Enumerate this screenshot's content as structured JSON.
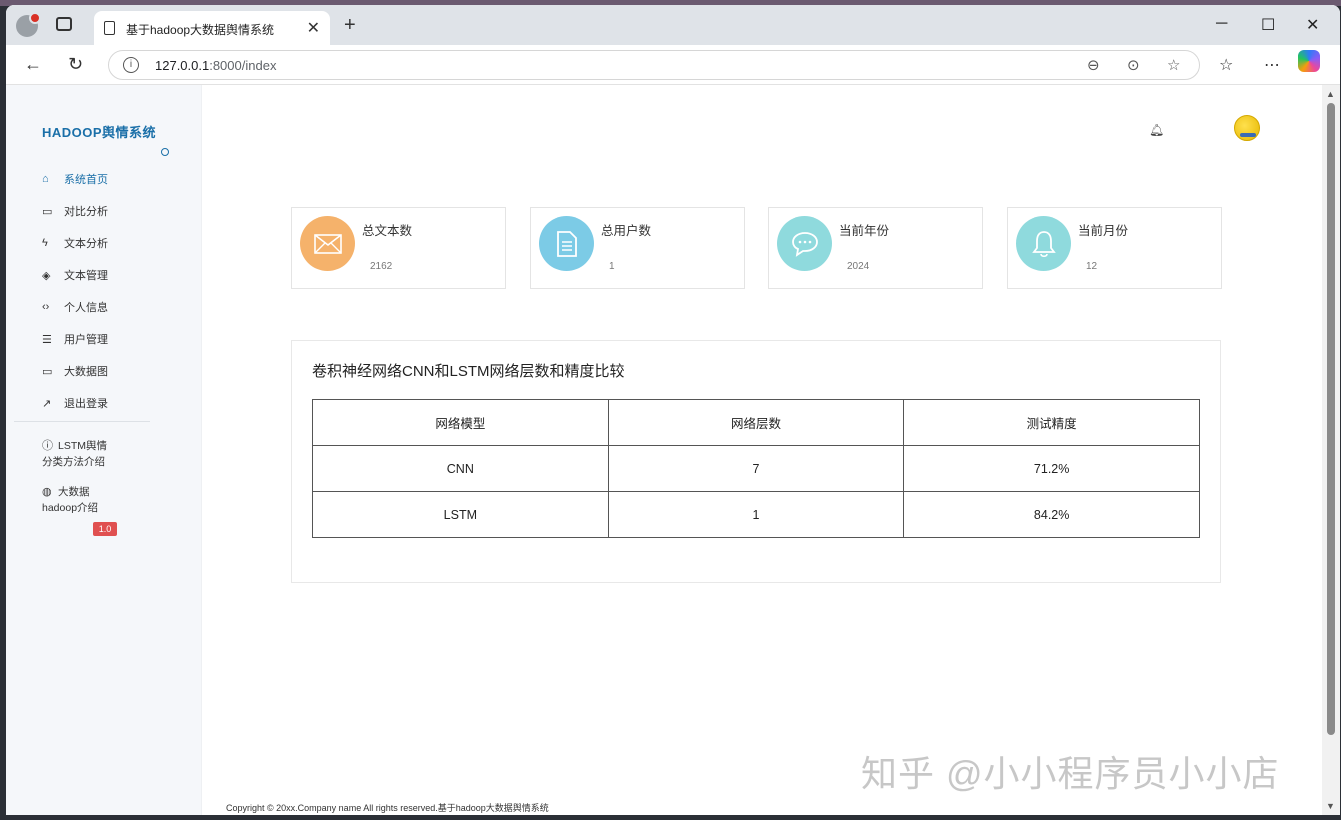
{
  "browser": {
    "tab_title": "基于hadoop大数据舆情系统",
    "url_host": "127.0.0.1",
    "url_path": ":8000/index"
  },
  "sidebar": {
    "brand": "HADOOP舆情系统",
    "items": [
      {
        "label": "系统首页",
        "icon": "home-icon",
        "glyph": "⌂"
      },
      {
        "label": "对比分析",
        "icon": "monitor-icon",
        "glyph": "▭"
      },
      {
        "label": "文本分析",
        "icon": "bolt-icon",
        "glyph": "ϟ"
      },
      {
        "label": "文本管理",
        "icon": "layers-icon",
        "glyph": "◈"
      },
      {
        "label": "个人信息",
        "icon": "code-icon",
        "glyph": "‹›"
      },
      {
        "label": "用户管理",
        "icon": "list-icon",
        "glyph": "☰"
      },
      {
        "label": "大数据图",
        "icon": "monitor-icon",
        "glyph": "▭"
      },
      {
        "label": "退出登录",
        "icon": "trend-icon",
        "glyph": "↗"
      }
    ],
    "extra": [
      {
        "line1": "LSTM舆情",
        "line2": "分类方法介绍",
        "icon": "help-icon",
        "glyph": "?"
      },
      {
        "line1": "大数据",
        "line2": "hadoop介绍",
        "icon": "globe-icon",
        "glyph": "◍"
      }
    ],
    "badge": "1.0"
  },
  "stats": [
    {
      "label": "总文本数",
      "value": "2162",
      "color": "#f5b26b",
      "icon": "mail-icon"
    },
    {
      "label": "总用户数",
      "value": "1",
      "color": "#7ccbe6",
      "icon": "document-icon"
    },
    {
      "label": "当前年份",
      "value": "2024",
      "color": "#8fdadd",
      "icon": "chat-icon"
    },
    {
      "label": "当前月份",
      "value": "12",
      "color": "#8fdadd",
      "icon": "bell-icon"
    }
  ],
  "comparison": {
    "title": "卷积神经网络CNN和LSTM网络层数和精度比较",
    "columns": [
      "网络模型",
      "网络层数",
      "测试精度"
    ],
    "rows": [
      [
        "CNN",
        "7",
        "71.2%"
      ],
      [
        "LSTM",
        "1",
        "84.2%"
      ]
    ]
  },
  "footer": "Copyright © 20xx.Company name All rights reserved.基于hadoop大数据舆情系统",
  "watermark": "知乎 @小小程序员小小店"
}
